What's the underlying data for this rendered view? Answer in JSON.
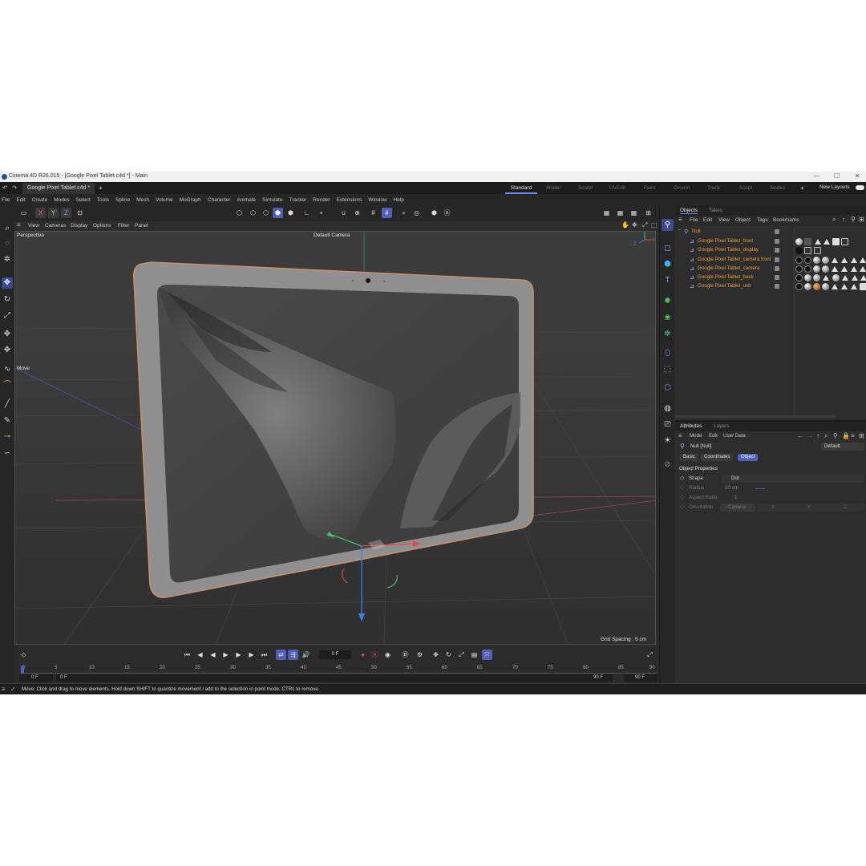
{
  "window": {
    "title": "Cinema 4D R26.015 - [Google Pixel Tablet.c4d *] - Main",
    "controls": [
      "—",
      "☐",
      "✕"
    ]
  },
  "tabs": {
    "document": "Google Pixel Tablet.c4d *",
    "add": "+",
    "layouts": [
      "Standard",
      "Model",
      "Sculpt",
      "UVEdit",
      "Paint",
      "Groom",
      "Track",
      "Script",
      "Nodes"
    ],
    "active_layout": "Standard",
    "plus": "+",
    "new_layouts": "New Layouts"
  },
  "menu": [
    "File",
    "Edit",
    "Create",
    "Modes",
    "Select",
    "Tools",
    "Spline",
    "Mesh",
    "Volume",
    "MoGraph",
    "Character",
    "Animate",
    "Simulate",
    "Tracker",
    "Render",
    "Extensions",
    "Window",
    "Help"
  ],
  "toolbar": {
    "axis_x": "X",
    "axis_y": "Y",
    "axis_z": "Z"
  },
  "viewport": {
    "menu": [
      "View",
      "Cameras",
      "Display",
      "Options",
      "Filter",
      "Panel"
    ],
    "label": "Perspective",
    "camera": "Default Camera",
    "move_label": "Move",
    "grid_spacing": "Grid Spacing : 5 cm"
  },
  "timeline": {
    "current_frame": "0 F",
    "ticks": [
      "0",
      "5",
      "10",
      "15",
      "20",
      "25",
      "30",
      "35",
      "40",
      "45",
      "50",
      "55",
      "60",
      "65",
      "70",
      "75",
      "80",
      "85",
      "90"
    ],
    "start_a": "0 F",
    "start_b": "0 F",
    "end_a": "90 F",
    "end_b": "90 F"
  },
  "status": {
    "message": "Move: Click and drag to move elements. Hold down SHIFT to quantize movement / add to the selection in point mode, CTRL to remove."
  },
  "objects_panel": {
    "tabs": [
      "Objects",
      "Takes"
    ],
    "menu": [
      "File",
      "Edit",
      "View",
      "Object",
      "Tags",
      "Bookmarks"
    ],
    "root": "Null",
    "items": [
      "Google Pixel Tablet_front",
      "Google Pixel Tablet_display",
      "Google Pixel Tablet_camera front",
      "Google Pixel Tablet_camera",
      "Google Pixel Tablet_back",
      "Google Pixel Tablet_usb"
    ]
  },
  "attributes_panel": {
    "tabs": [
      "Attributes",
      "Layers"
    ],
    "menu": [
      "Mode",
      "Edit",
      "User Data"
    ],
    "object_name": "Null [Null]",
    "preset": "Default",
    "subtabs": [
      "Basic",
      "Coordinates",
      "Object"
    ],
    "active_subtab": "Object",
    "section": "Object Properties",
    "fields": {
      "shape_label": "Shape",
      "shape_value": "Dot",
      "radius_label": "Radius",
      "radius_value": "10 cm",
      "aspect_label": "Aspect Ratio",
      "aspect_value": "1",
      "orientation_label": "Orientation",
      "orientation_value": "Camera",
      "orient_x": "X",
      "orient_y": "Y",
      "orient_z": "Z"
    }
  },
  "colors": {
    "accent": "#5060b8",
    "object_name": "#f09a3a",
    "background": "#2b2b2b",
    "viewport": "#3a3a3a"
  }
}
